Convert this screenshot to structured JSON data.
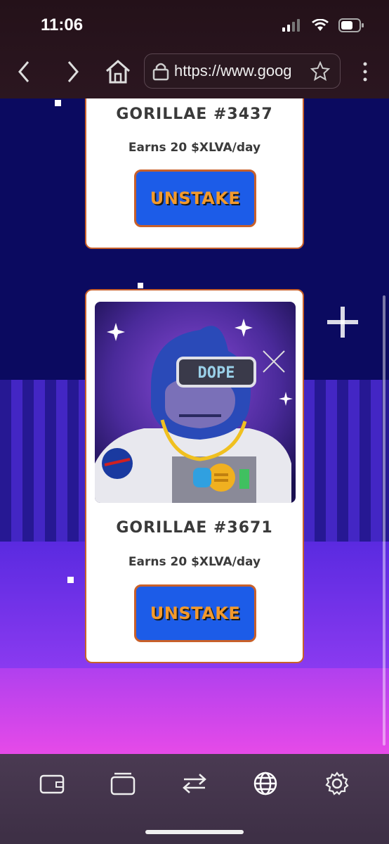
{
  "status_bar": {
    "time": "11:06"
  },
  "browser": {
    "url": "https://www.goog",
    "back_icon": "chevron-left-icon",
    "forward_icon": "chevron-right-icon",
    "home_icon": "home-icon",
    "lock_icon": "lock-icon",
    "bookmark_icon": "star-icon",
    "menu_icon": "more-vertical-icon"
  },
  "cards": [
    {
      "title": "GORILLAE #3437",
      "earn": "Earns 20 $XLVA/day",
      "button": "UNSTAKE"
    },
    {
      "title": "GORILLAE #3671",
      "earn": "Earns 20 $XLVA/day",
      "button": "UNSTAKE",
      "image_text": "DOPE"
    }
  ],
  "toolbar": {
    "items": [
      "wallet-icon",
      "tabs-icon",
      "swap-icon",
      "globe-icon",
      "gear-icon"
    ]
  },
  "colors": {
    "accent": "#1c5ce8",
    "border": "#c8602a",
    "button_text": "#f39a2c"
  }
}
